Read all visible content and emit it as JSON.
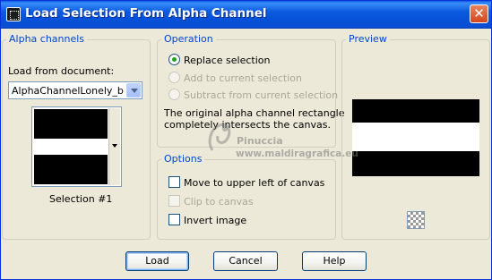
{
  "window": {
    "title": "Load Selection From Alpha Channel",
    "close_glyph": "✕"
  },
  "alpha_channels": {
    "legend": "Alpha channels",
    "load_from_label": "Load from document:",
    "document_value": "AlphaChannelLonely_byRo",
    "selection_label": "Selection #1"
  },
  "operation": {
    "legend": "Operation",
    "options": [
      {
        "label": "Replace selection",
        "checked": true,
        "enabled": true
      },
      {
        "label": "Add to current selection",
        "checked": false,
        "enabled": false
      },
      {
        "label": "Subtract from current selection",
        "checked": false,
        "enabled": false
      }
    ],
    "info_line1": "The original alpha channel rectangle",
    "info_line2": "completely intersects the canvas."
  },
  "options": {
    "legend": "Options",
    "items": [
      {
        "label": "Move to upper left of canvas",
        "checked": false,
        "enabled": true
      },
      {
        "label": "Clip to canvas",
        "checked": false,
        "enabled": false
      },
      {
        "label": "Invert image",
        "checked": false,
        "enabled": true
      }
    ]
  },
  "preview": {
    "legend": "Preview"
  },
  "buttons": {
    "load": "Load",
    "cancel": "Cancel",
    "help": "Help"
  },
  "watermark": {
    "name": "Pinuccia",
    "site": "www.maldiragrafica.eu"
  },
  "colors": {
    "title_bar": "#0a5fe8",
    "legend": "#0046d5",
    "radio_checked": "#21a121",
    "dialog_bg": "#ece9d8"
  }
}
